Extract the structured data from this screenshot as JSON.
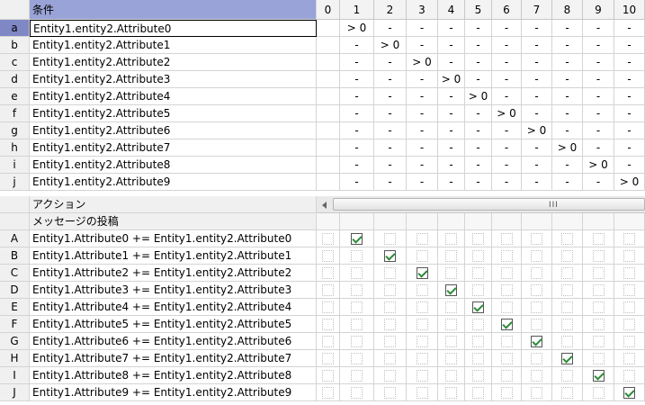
{
  "conditions": {
    "header_label": "条件",
    "columns": [
      "0",
      "1",
      "2",
      "3",
      "4",
      "5",
      "6",
      "7",
      "8",
      "9",
      "10"
    ],
    "rows": [
      {
        "id": "a",
        "label": "Entity1.entity2.Attribute0",
        "values": [
          "",
          "> 0",
          "-",
          "-",
          "-",
          "-",
          "-",
          "-",
          "-",
          "-",
          "-"
        ]
      },
      {
        "id": "b",
        "label": "Entity1.entity2.Attribute1",
        "values": [
          "",
          "-",
          "> 0",
          "-",
          "-",
          "-",
          "-",
          "-",
          "-",
          "-",
          "-"
        ]
      },
      {
        "id": "c",
        "label": "Entity1.entity2.Attribute2",
        "values": [
          "",
          "-",
          "-",
          "> 0",
          "-",
          "-",
          "-",
          "-",
          "-",
          "-",
          "-"
        ]
      },
      {
        "id": "d",
        "label": "Entity1.entity2.Attribute3",
        "values": [
          "",
          "-",
          "-",
          "-",
          "> 0",
          "-",
          "-",
          "-",
          "-",
          "-",
          "-"
        ]
      },
      {
        "id": "e",
        "label": "Entity1.entity2.Attribute4",
        "values": [
          "",
          "-",
          "-",
          "-",
          "-",
          "> 0",
          "-",
          "-",
          "-",
          "-",
          "-"
        ]
      },
      {
        "id": "f",
        "label": "Entity1.entity2.Attribute5",
        "values": [
          "",
          "-",
          "-",
          "-",
          "-",
          "-",
          "> 0",
          "-",
          "-",
          "-",
          "-"
        ]
      },
      {
        "id": "g",
        "label": "Entity1.entity2.Attribute6",
        "values": [
          "",
          "-",
          "-",
          "-",
          "-",
          "-",
          "-",
          "> 0",
          "-",
          "-",
          "-"
        ]
      },
      {
        "id": "h",
        "label": "Entity1.entity2.Attribute7",
        "values": [
          "",
          "-",
          "-",
          "-",
          "-",
          "-",
          "-",
          "-",
          "> 0",
          "-",
          "-"
        ]
      },
      {
        "id": "i",
        "label": "Entity1.entity2.Attribute8",
        "values": [
          "",
          "-",
          "-",
          "-",
          "-",
          "-",
          "-",
          "-",
          "-",
          "> 0",
          "-"
        ]
      },
      {
        "id": "j",
        "label": "Entity1.entity2.Attribute9",
        "values": [
          "",
          "-",
          "-",
          "-",
          "-",
          "-",
          "-",
          "-",
          "-",
          "-",
          "> 0"
        ]
      }
    ]
  },
  "actions": {
    "header_label": "アクション",
    "sub_header_label": "メッセージの投稿",
    "rows": [
      {
        "id": "A",
        "label": "Entity1.Attribute0 += Entity1.entity2.Attribute0",
        "checked_col": 1
      },
      {
        "id": "B",
        "label": "Entity1.Attribute1 += Entity1.entity2.Attribute1",
        "checked_col": 2
      },
      {
        "id": "C",
        "label": "Entity1.Attribute2 += Entity1.entity2.Attribute2",
        "checked_col": 3
      },
      {
        "id": "D",
        "label": "Entity1.Attribute3 += Entity1.entity2.Attribute3",
        "checked_col": 4
      },
      {
        "id": "E",
        "label": "Entity1.Attribute4 += Entity1.entity2.Attribute4",
        "checked_col": 5
      },
      {
        "id": "F",
        "label": "Entity1.Attribute5 += Entity1.entity2.Attribute5",
        "checked_col": 6
      },
      {
        "id": "G",
        "label": "Entity1.Attribute6 += Entity1.entity2.Attribute6",
        "checked_col": 7
      },
      {
        "id": "H",
        "label": "Entity1.Attribute7 += Entity1.entity2.Attribute7",
        "checked_col": 8
      },
      {
        "id": "I",
        "label": "Entity1.Attribute8 += Entity1.entity2.Attribute8",
        "checked_col": 9
      },
      {
        "id": "J",
        "label": "Entity1.Attribute9 += Entity1.entity2.Attribute9",
        "checked_col": 10
      }
    ]
  },
  "scrollbar": {
    "left_arrow_icon": "arrow-left-icon",
    "grip_text": "III"
  },
  "colors": {
    "selected_row": "#7f88c5",
    "header": "#9aa3d8",
    "check": "#2e8b3a"
  }
}
